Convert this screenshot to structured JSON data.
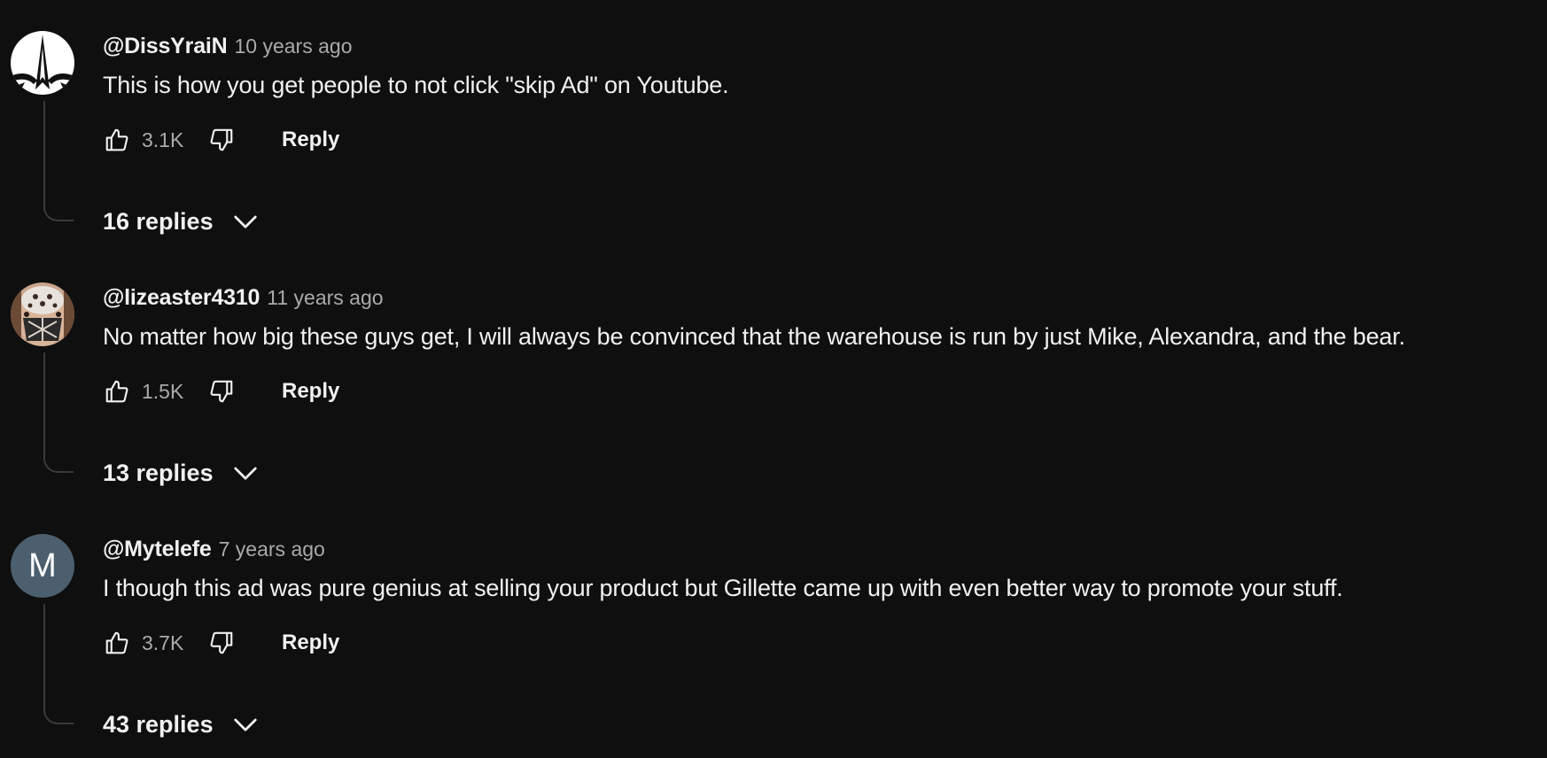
{
  "comments": [
    {
      "author": "@DissYraiN",
      "time": "10 years ago",
      "text": "This is how you get people to not click \"skip Ad\" on Youtube.",
      "likes": "3.1K",
      "reply_label": "Reply",
      "replies_label": "16 replies",
      "avatar_icon": "spire-logo-avatar"
    },
    {
      "author": "@lizeaster4310",
      "time": "11 years ago",
      "text": "No matter how big these guys get, I will always be convinced that the warehouse is run by just Mike, Alexandra, and the bear.",
      "likes": "1.5K",
      "reply_label": "Reply",
      "replies_label": "13 replies",
      "avatar_icon": "patterned-face-avatar"
    },
    {
      "author": "@Mytelefe",
      "time": "7 years ago",
      "text": "I though this ad was pure genius at selling your product but Gillette came up with even better way to promote your stuff.",
      "likes": "3.7K",
      "reply_label": "Reply",
      "replies_label": "43 replies",
      "avatar_letter": "M",
      "avatar_color": "#4b5f6e"
    }
  ],
  "icons": {
    "like": "thumbs-up-icon",
    "dislike": "thumbs-down-icon",
    "expand": "chevron-down-icon"
  },
  "colors": {
    "background": "#0f0f0f",
    "text_primary": "#f1f1f1",
    "text_secondary": "#aaaaaa"
  }
}
